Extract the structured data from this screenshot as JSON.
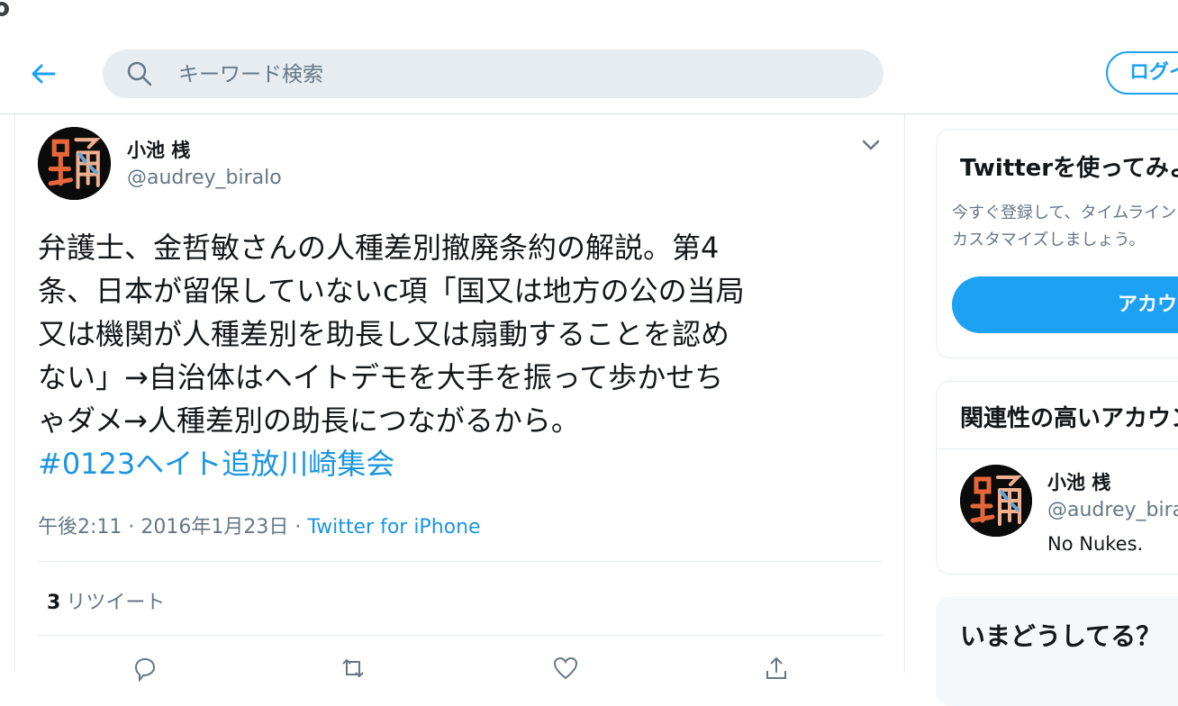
{
  "header": {
    "search_placeholder": "キーワード検索",
    "login_label": "ログイン"
  },
  "tweet": {
    "author_name": "小池 桟",
    "author_handle": "@audrey_biralo",
    "text_lines": [
      "弁護士、金哲敏さんの人種差別撤廃条約の解説。第4",
      "条、日本が留保していないc項「国又は地方の公の当局",
      "又は機関が人種差別を助長し又は扇動することを認め",
      "ない」→自治体はヘイトデモを大手を振って歩かせち",
      "ゃダメ→人種差別の助長につながるから。"
    ],
    "hashtag": "#0123ヘイト追放川崎集会",
    "time_date": "午後2:11 · 2016年1月23日 · ",
    "source": "Twitter for iPhone",
    "retweet_count": "3",
    "retweet_label": "リツイート"
  },
  "signup_card": {
    "title": "Twitterを使ってみよう",
    "description": "今すぐ登録して、タイムラインをカスタマイズしましょう。",
    "button_label": "アカウント作成"
  },
  "related_card": {
    "title": "関連性の高いアカウント",
    "account_name": "小池 桟",
    "account_handle": "@audrey_biralo",
    "account_bio": "No Nukes."
  },
  "trends_card": {
    "title": "いまどうしてる？"
  },
  "colors": {
    "accent": "#1da1f2",
    "link": "#1b95e0",
    "secondary_text": "#657786",
    "search_bg": "#e6ecf0"
  },
  "icons": [
    "globe-icon",
    "back-arrow-icon",
    "search-icon",
    "chevron-down-icon",
    "reply-icon",
    "retweet-icon",
    "like-icon",
    "share-icon"
  ]
}
